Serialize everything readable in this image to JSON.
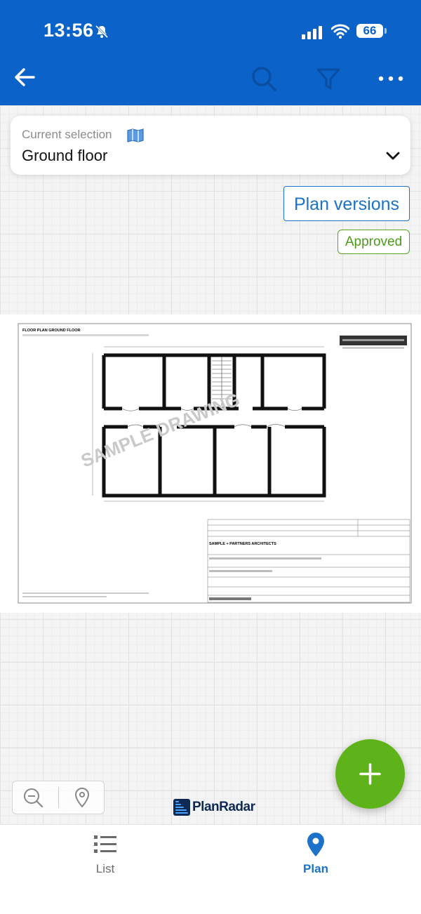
{
  "status_bar": {
    "time": "13:56",
    "battery": "66"
  },
  "header": {
    "icons": [
      "back-arrow-icon",
      "search-icon",
      "filter-icon",
      "more-icon"
    ]
  },
  "selection": {
    "label": "Current selection",
    "value": "Ground floor"
  },
  "plan": {
    "versions_label": "Plan versions",
    "status": "Approved",
    "drawing_title": "FLOOR PLAN GROUND FLOOR",
    "watermark": "SAMPLE DRAWING",
    "firm": "SAMPLE + PARTNERS ARCHITECTS"
  },
  "branding": {
    "logo_text": "PlanRadar"
  },
  "tabs": [
    {
      "label": "List"
    },
    {
      "label": "Plan"
    }
  ],
  "colors": {
    "header": "#0b63c9",
    "accent": "#1c72c8",
    "approved": "#5aa41e",
    "fab": "#5fb31a",
    "active_tab": "#1c72c8",
    "inactive_tab": "#6b6b6b"
  }
}
